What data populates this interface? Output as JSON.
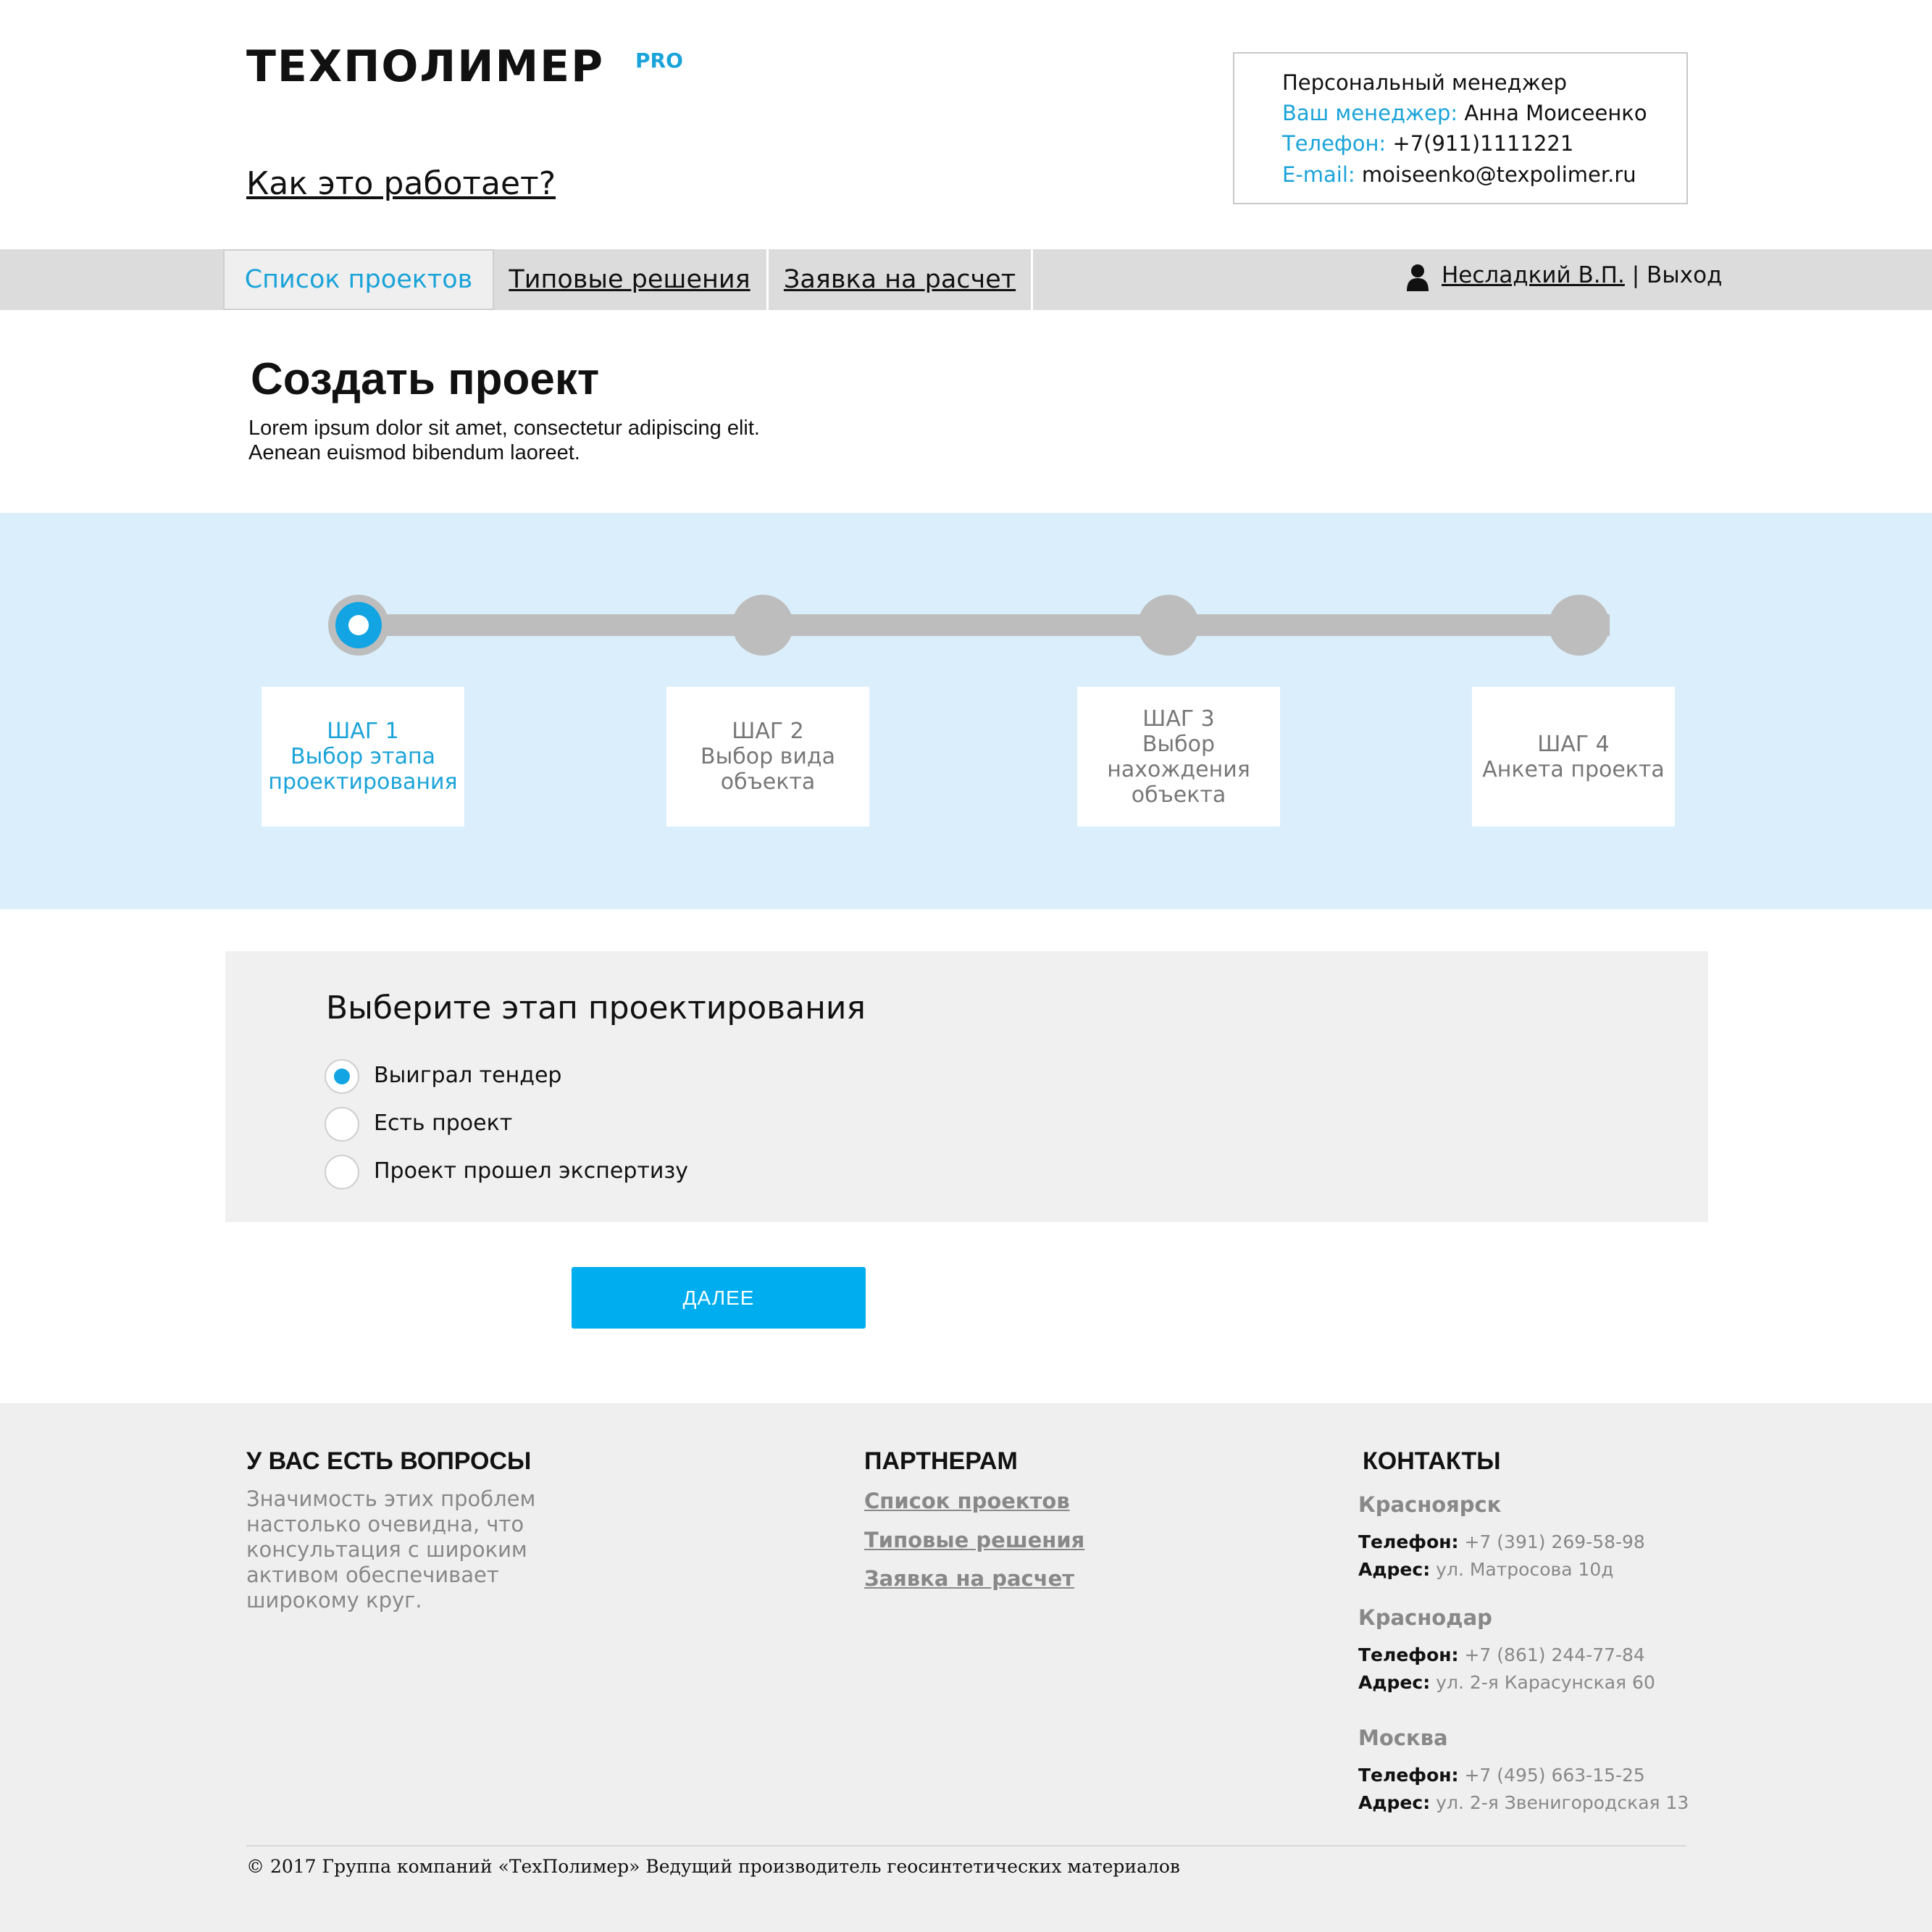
{
  "header": {
    "logo_text": "ТЕХПОЛИМЕР",
    "logo_suffix": "PRO",
    "how_it_works": "Как это работает?"
  },
  "manager": {
    "title": "Персональный менеджер",
    "name_label": "Ваш менеджер:",
    "name": "Анна Моисеенко",
    "phone_label": "Телефон:",
    "phone": "+7(911)1111221",
    "email_label": "E-mail:",
    "email": "moiseenko@texpolimer.ru"
  },
  "nav": {
    "tabs": [
      {
        "label": "Список проектов"
      },
      {
        "label": "Типовые решения"
      },
      {
        "label": "Заявка на расчет"
      }
    ],
    "user_name": "Несладкий В.П.",
    "separator": " | ",
    "logout": "Выход"
  },
  "page": {
    "title": "Создать проект",
    "lead_line1": "Lorem ipsum dolor sit amet, consectetur adipiscing elit.",
    "lead_line2": "Aenean euismod bibendum laoreet."
  },
  "progress": {
    "current_step": 1,
    "total_steps": 4
  },
  "steps": [
    {
      "num": "ШАГ 1",
      "lines": [
        "Выбор этапа",
        "проектирования"
      ]
    },
    {
      "num": "ШАГ 2",
      "lines": [
        "Выбор вида",
        "объекта"
      ]
    },
    {
      "num": "ШАГ 3",
      "lines": [
        "Выбор",
        "нахождения",
        "объекта"
      ]
    },
    {
      "num": "ШАГ 4",
      "lines": [
        "Анкета проекта"
      ]
    }
  ],
  "form": {
    "title": "Выберите этап проектирования",
    "options": [
      {
        "label": "Выиграл тендер",
        "checked": true
      },
      {
        "label": "Есть проект",
        "checked": false
      },
      {
        "label": "Проект прошел экспертизу",
        "checked": false
      }
    ],
    "next_button": "ДАЛЕЕ"
  },
  "footer": {
    "questions_title": "У ВАС ЕСТЬ ВОПРОСЫ",
    "questions_text": [
      "Значимость этих проблем",
      "настолько очевидна, что",
      "консультация с широким",
      "активом обеспечивает",
      "широкому круг."
    ],
    "partners_title": "ПАРТНЕРАМ",
    "partner_links": [
      "Список проектов",
      "Типовые решения",
      "Заявка на расчет"
    ],
    "contacts_title": "КОНТАКТЫ",
    "phone_label": "Телефон:",
    "address_label": "Адрес:",
    "cities": [
      {
        "city": "Красноярск",
        "phone": "+7 (391) 269-58-98",
        "address": "ул. Матросова 10д"
      },
      {
        "city": "Краснодар",
        "phone": "+7 (861) 244-77-84",
        "address": "ул. 2-я Карасунская 60"
      },
      {
        "city": "Москва",
        "phone": "+7 (495) 663-15-25",
        "address": "ул. 2-я Звенигородская 13"
      }
    ],
    "copyright": "© 2017 Группа компаний «ТехПолимер» Ведущий производитель геосинтетических материалов"
  },
  "colors": {
    "accent": "#1aa3d9",
    "button": "#00aeef",
    "band": "#dbeefb",
    "nav": "#dcdcdc",
    "footer": "#efefef"
  }
}
